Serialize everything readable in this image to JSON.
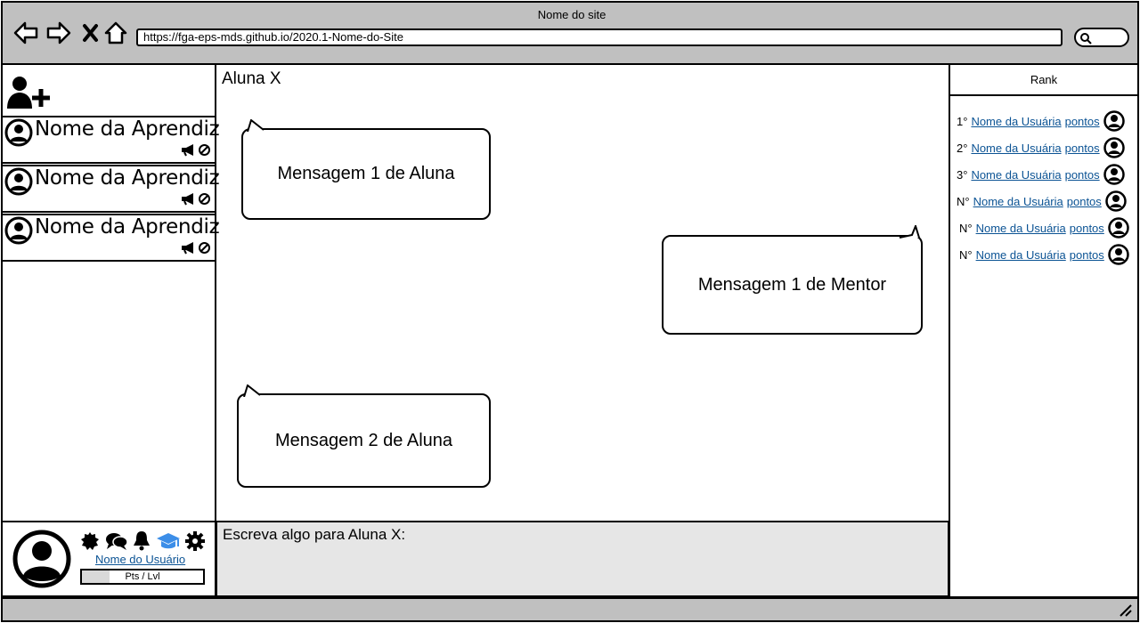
{
  "browser": {
    "site_title": "Nome do site",
    "url": "https://fga-eps-mds.github.io/2020.1-Nome-do-Site"
  },
  "students": [
    {
      "name": "Nome da Aprendiz"
    },
    {
      "name": "Nome da Aprendiz"
    },
    {
      "name": "Nome da Aprendiz"
    }
  ],
  "chat": {
    "title": "Aluna X",
    "messages": [
      {
        "text": "Mensagem 1 de Aluna"
      },
      {
        "text": "Mensagem 1 de Mentor"
      },
      {
        "text": "Mensagem 2 de Aluna"
      }
    ],
    "compose_label": "Escreva algo para Aluna X:"
  },
  "rank": {
    "title": "Rank",
    "rows": [
      {
        "position": "1°",
        "user": "Nome da Usuária",
        "points": "pontos"
      },
      {
        "position": "2°",
        "user": "Nome da Usuária",
        "points": "pontos"
      },
      {
        "position": "3°",
        "user": "Nome da Usuária",
        "points": "pontos"
      },
      {
        "position": "N°",
        "user": "Nome da Usuária",
        "points": "pontos"
      },
      {
        "position": "N°",
        "user": "Nome da Usuária",
        "points": "pontos"
      },
      {
        "position": "N°",
        "user": "Nome da Usuária",
        "points": "pontos"
      }
    ]
  },
  "user": {
    "name": "Nome do Usuário",
    "points_level_label": "Pts / Lvl",
    "progress": 0.23
  },
  "colors": {
    "chrome": "#c0c0c0",
    "compose_bg": "#e6e6e6",
    "link": "#0b5394",
    "mentor_icon": "#3c8ee8"
  }
}
